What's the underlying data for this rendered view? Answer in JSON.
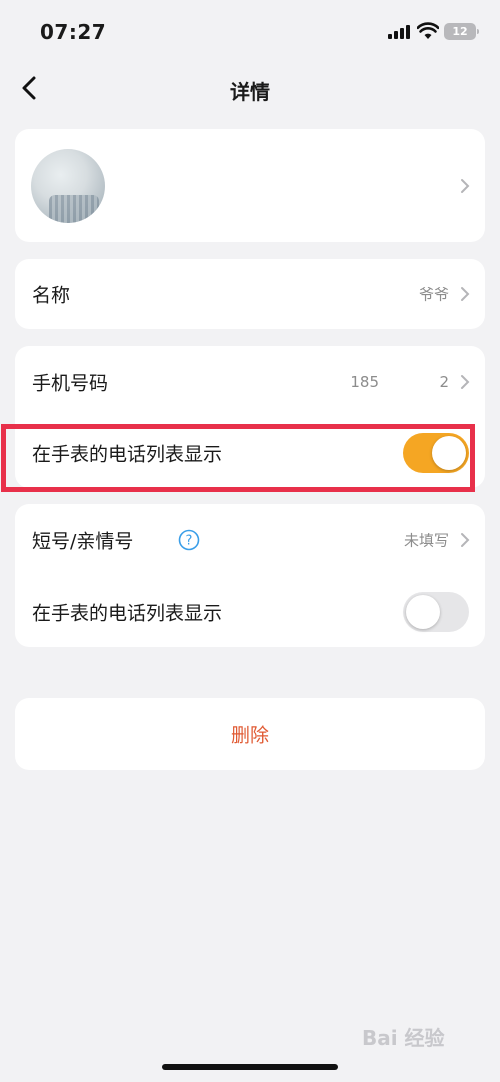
{
  "status_bar": {
    "time": "07:27",
    "battery": "12"
  },
  "nav": {
    "title": "详情"
  },
  "contact": {
    "name_label": "名称",
    "name_value": "爷爷",
    "phone_label": "手机号码",
    "phone_value": "185",
    "phone_value_end": "2",
    "show_on_watch_label": "在手表的电话列表显示",
    "show_on_watch": true
  },
  "short_number": {
    "label": "短号/亲情号",
    "value": "未填写",
    "show_on_watch_label": "在手表的电话列表显示",
    "show_on_watch": false
  },
  "actions": {
    "delete_label": "删除"
  },
  "watermark": "Bai 经验",
  "colors": {
    "accent": "#f5a623",
    "danger": "#e05a33",
    "highlight": "#e8304a"
  }
}
